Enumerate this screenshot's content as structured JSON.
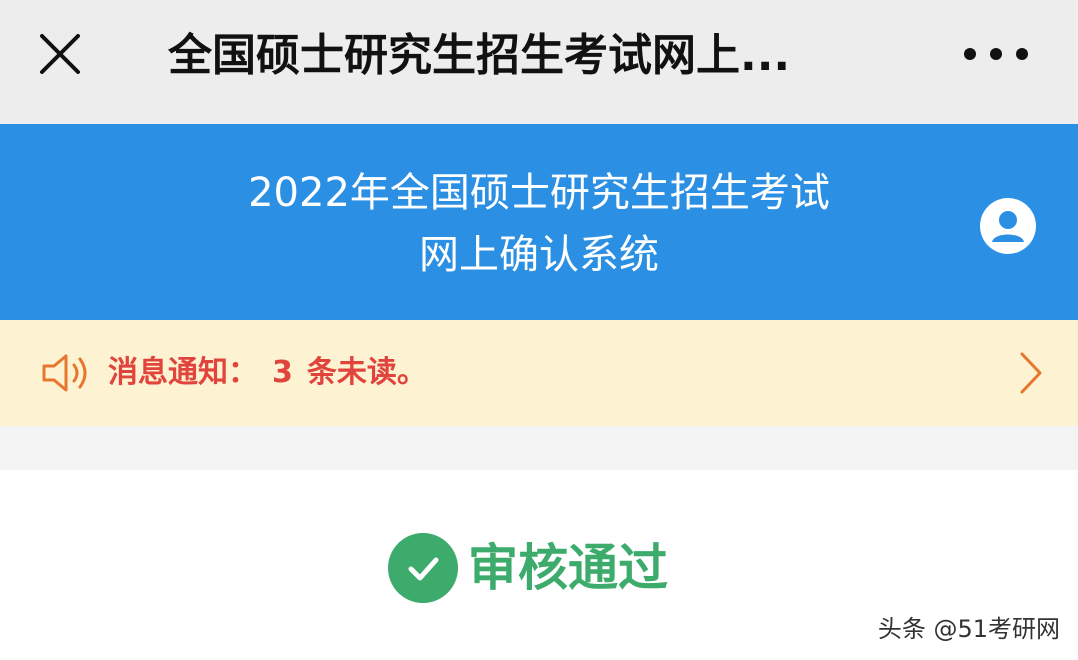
{
  "nav": {
    "title": "全国硕士研究生招生考试网上...",
    "close_icon": "close-icon",
    "more_icon": "more-dots-icon"
  },
  "header": {
    "title_line1": "2022年全国硕士研究生招生考试",
    "title_line2": "网上确认系统",
    "user_icon": "user-avatar-icon"
  },
  "notice": {
    "label": "消息通知：",
    "count": "3",
    "suffix": "条未读。",
    "speaker_icon": "speaker-icon",
    "chevron_icon": "chevron-right-icon"
  },
  "status": {
    "label": "审核通过",
    "icon": "check-circle-icon"
  },
  "footer": {
    "credit": "头条 @51考研网"
  },
  "colors": {
    "blue_header": "#2b8fe3",
    "notice_bg": "#fdf2d1",
    "notice_text": "#e0443c",
    "success_green": "#3dab6b"
  }
}
